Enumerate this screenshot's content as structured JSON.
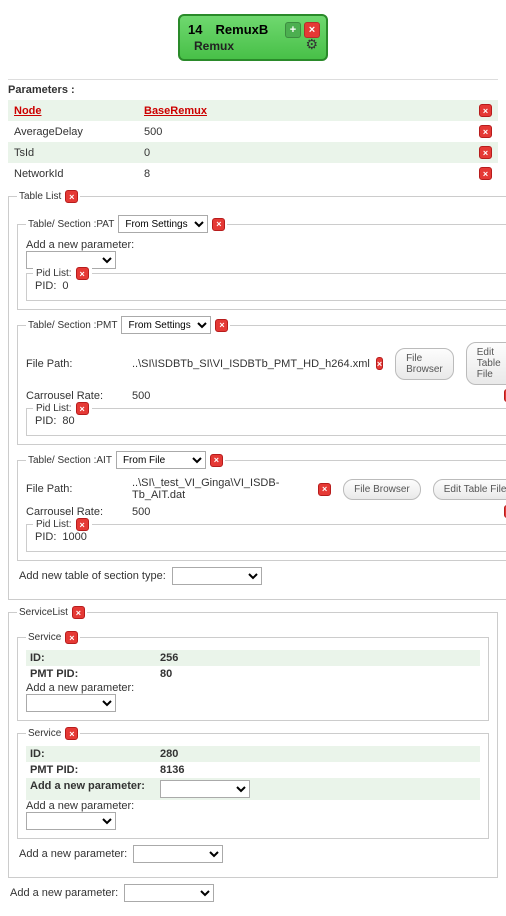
{
  "header": {
    "number": "14",
    "title": "RemuxB",
    "subtitle": "Remux"
  },
  "parameters": {
    "title": "Parameters :",
    "rows": [
      {
        "label": "Node",
        "value": "BaseRemux",
        "is_node": true
      },
      {
        "label": "AverageDelay",
        "value": "500"
      },
      {
        "label": "TsId",
        "value": "0"
      },
      {
        "label": "NetworkId",
        "value": "8"
      }
    ]
  },
  "table_list": {
    "legend": "Table List",
    "sections": [
      {
        "legend_label": "Table/ Section :PAT",
        "source_select": "From Settings",
        "add_param_label": "Add a new parameter:",
        "pid_list": {
          "legend": "Pid List:",
          "label": "PID:",
          "value": "0"
        }
      },
      {
        "legend_label": "Table/ Section :PMT",
        "source_select": "From Settings",
        "file_path_label": "File Path:",
        "file_path_value": "..\\SI\\ISDBTb_SI\\VI_ISDBTb_PMT_HD_h264.xml",
        "file_browser_btn": "File Browser",
        "edit_table_btn": "Edit Table File",
        "carousel_label": "Carrousel Rate:",
        "carousel_value": "500",
        "pid_list": {
          "legend": "Pid List:",
          "label": "PID:",
          "value": "80"
        }
      },
      {
        "legend_label": "Table/ Section :AIT",
        "source_select": "From File",
        "file_path_label": "File Path:",
        "file_path_value": "..\\SI\\_test_VI_Ginga\\VI_ISDB-Tb_AIT.dat",
        "file_browser_btn": "File Browser",
        "edit_table_btn": "Edit Table File",
        "carousel_label": "Carrousel Rate:",
        "carousel_value": "500",
        "pid_list": {
          "legend": "Pid List:",
          "label": "PID:",
          "value": "1000"
        }
      }
    ],
    "add_table_label": "Add new table of section type:"
  },
  "service_list": {
    "legend": "ServiceList",
    "services": [
      {
        "legend": "Service",
        "rows": [
          {
            "k": "ID:",
            "v": "256"
          },
          {
            "k": "PMT PID:",
            "v": "80"
          }
        ],
        "add_param_label": "Add a new parameter:"
      },
      {
        "legend": "Service",
        "rows": [
          {
            "k": "ID:",
            "v": "280"
          },
          {
            "k": "PMT PID:",
            "v": "8136"
          }
        ],
        "add_param_high_label": "Add a new parameter:",
        "add_param_label": "Add a new parameter:"
      }
    ],
    "add_param_label": "Add a new parameter:"
  },
  "footer_add_param": "Add a new parameter:"
}
